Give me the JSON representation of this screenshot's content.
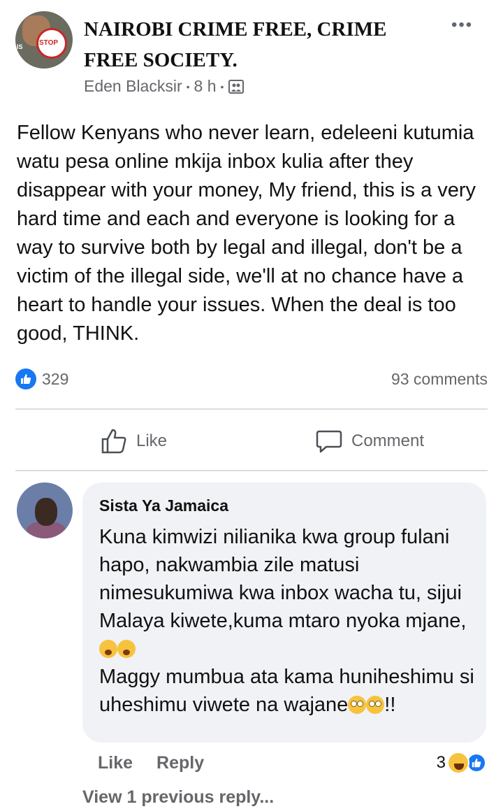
{
  "post": {
    "group_name": "NAIROBI CRIME FREE, CRIME FREE SOCIETY.",
    "author": "Eden Blacksir",
    "time": "8 h",
    "separator": "•",
    "privacy_icon": "group-privacy-icon",
    "more_icon": "•••",
    "avatar_logo_text": "STOP",
    "avatar_side_text": "IS",
    "body": "Fellow Kenyans who never learn, edeleeni kutumia watu pesa online mkija inbox kulia after they disappear with your money, My friend, this is a very hard time and each and everyone is looking for a way to survive both by legal and  illegal, don't be a victim of the illegal side, we'll at no chance have a heart to handle your issues. When the deal is too good, THINK."
  },
  "stats": {
    "likes": "329",
    "comments": "93 comments"
  },
  "actions": {
    "like_label": "Like",
    "comment_label": "Comment"
  },
  "comment": {
    "name": "Sista Ya Jamaica",
    "text_part1": "Kuna kimwizi nilianika kwa group fulani hapo, nakwambia zile matusi nimesukumiwa kwa inbox wacha tu, sijui Malaya kiwete,kuma mtaro nyoka mjane,",
    "text_part2": "Maggy mumbua ata kama huniheshimu si uheshimu viwete na wajane",
    "text_end": "!!",
    "like_label": "Like",
    "reply_label": "Reply",
    "reaction_count": "3"
  },
  "view_replies": "View 1 previous reply...",
  "colors": {
    "accent": "#1877f2",
    "secondary_text": "#65676b",
    "bubble": "#f0f2f5"
  }
}
